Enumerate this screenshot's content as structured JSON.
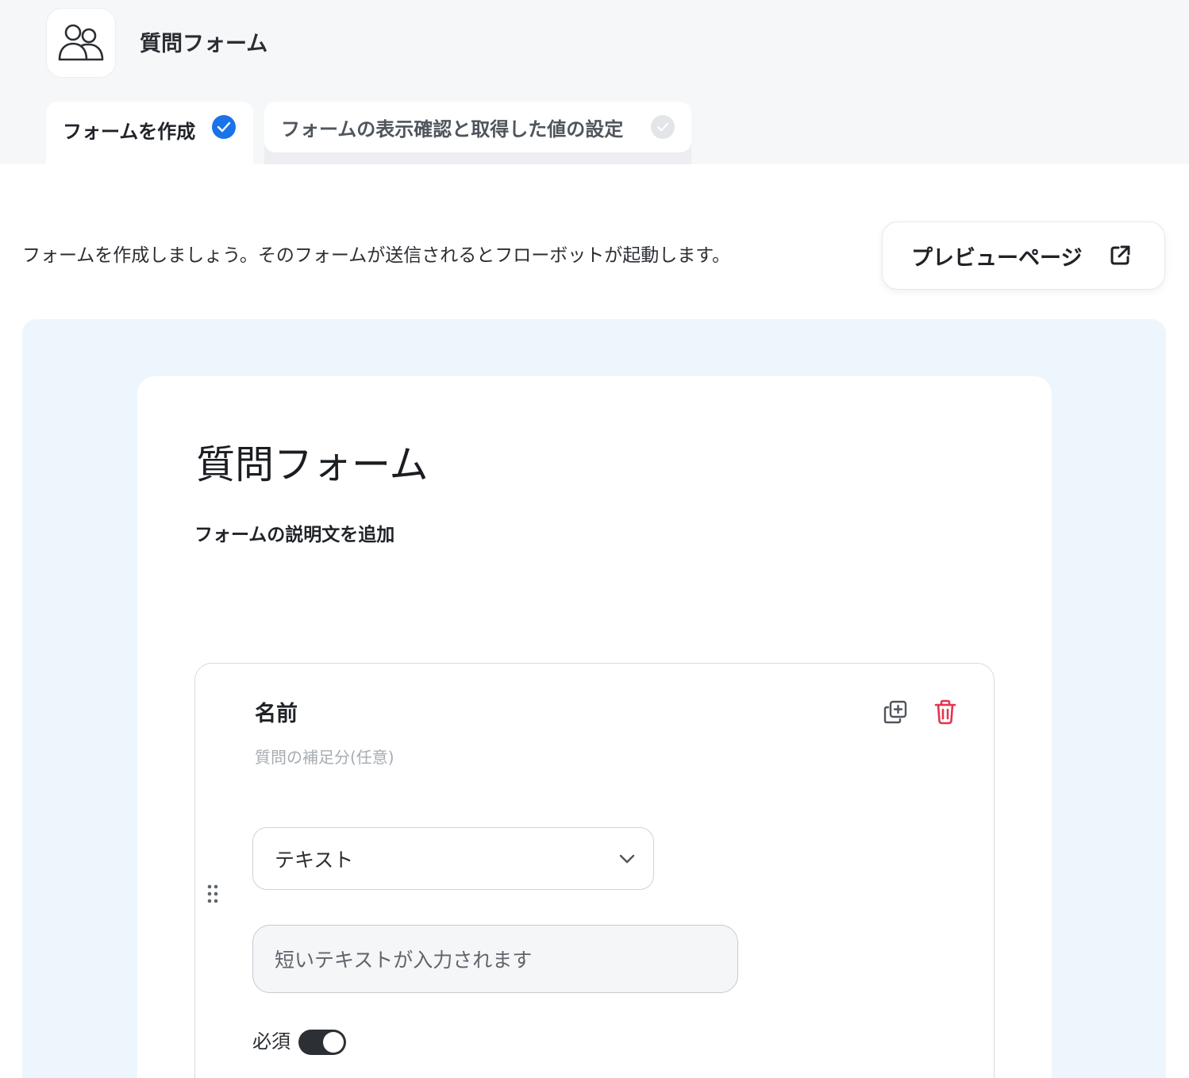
{
  "header": {
    "app_title": "質問フォーム",
    "app_icon": "users-icon"
  },
  "tabs": [
    {
      "label": "フォームを作成",
      "status": "complete",
      "active": true
    },
    {
      "label": "フォームの表示確認と取得した値の設定",
      "status": "pending",
      "active": false
    }
  ],
  "intro_text": "フォームを作成しましょう。そのフォームが送信されるとフローボットが起動します。",
  "preview_button": {
    "label": "プレビューページ",
    "icon": "external-link-icon"
  },
  "form": {
    "title": "質問フォーム",
    "description_placeholder": "フォームの説明文を追加"
  },
  "question": {
    "title": "名前",
    "subtitle_placeholder": "質問の補足分(任意)",
    "type_selected": "テキスト",
    "answer_placeholder": "短いテキストが入力されます",
    "required_label": "必須",
    "required": true
  },
  "colors": {
    "accent": "#1a73e8",
    "delete": "#e5334f",
    "canvas_bg": "#eef6fd",
    "toggle_on": "#2c3034"
  }
}
